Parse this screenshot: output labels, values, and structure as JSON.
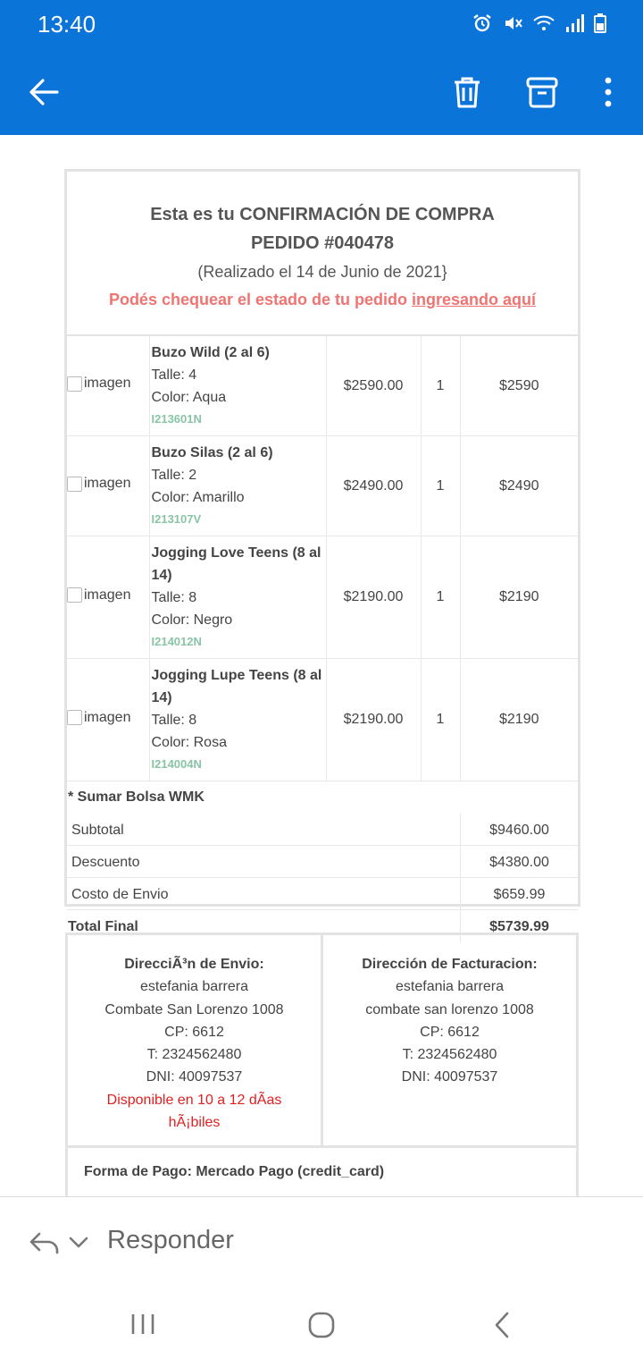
{
  "status": {
    "time": "13:40"
  },
  "appbar": {
    "back_icon": "arrow-left-icon",
    "delete_icon": "trash-icon",
    "archive_icon": "archive-icon",
    "more_icon": "more-vertical-icon"
  },
  "email": {
    "title": "Esta es tu CONFIRMACIÓN DE COMPRA",
    "order": "PEDIDO #040478",
    "date": "(Realizado el 14 de Junio de 2021}",
    "check_text": "Podés chequear el estado de tu pedido ",
    "check_link": "ingresando aquí",
    "items": [
      {
        "image_alt": "imagen",
        "name": "Buzo Wild (2 al 6)",
        "size": "Talle: 4",
        "color": "Color: Aqua",
        "sku": "I213601N",
        "price": "$2590.00",
        "qty": "1",
        "total": "$2590"
      },
      {
        "image_alt": "imagen",
        "name": "Buzo Silas (2 al 6)",
        "size": "Talle: 2",
        "color": "Color: Amarillo",
        "sku": "I213107V",
        "price": "$2490.00",
        "qty": "1",
        "total": "$2490"
      },
      {
        "image_alt": "imagen",
        "name": "Jogging Love Teens (8 al 14)",
        "size": "Talle: 8",
        "color": "Color: Negro",
        "sku": "I214012N",
        "price": "$2190.00",
        "qty": "1",
        "total": "$2190"
      },
      {
        "image_alt": "imagen",
        "name": "Jogging Lupe Teens (8 al 14)",
        "size": "Talle: 8",
        "color": "Color: Rosa",
        "sku": "I214004N",
        "price": "$2190.00",
        "qty": "1",
        "total": "$2190"
      }
    ],
    "bolsa": "* Sumar Bolsa WMK",
    "summary": {
      "subtotal_label": "Subtotal",
      "subtotal": "$9460.00",
      "discount_label": "Descuento",
      "discount": "$4380.00",
      "shipping_label": "Costo de Envio",
      "shipping": "$659.99",
      "final_label": "Total Final",
      "final": "$5739.99"
    },
    "shipping_address": {
      "title": "DirecciÃ³n de Envio:",
      "name": "estefania barrera",
      "street": "Combate San Lorenzo 1008",
      "cp": "CP: 6612",
      "phone": "T: 2324562480",
      "dni": "DNI: 40097537",
      "availability": "Disponible en 10 a 12 dÃas hÃ¡biles"
    },
    "billing_address": {
      "title": "Dirección de Facturacion:",
      "name": "estefania barrera",
      "street": "combate san lorenzo 1008",
      "cp": "CP: 6612",
      "phone": "T: 2324562480",
      "dni": "DNI: 40097537"
    },
    "payment": "Forma de Pago: Mercado Pago (credit_card)"
  },
  "reply": {
    "label": "Responder"
  },
  "colors": {
    "appbar": "#0a74d8",
    "link": "#ef7472",
    "sku": "#89c4a5",
    "availability": "#e02020"
  }
}
